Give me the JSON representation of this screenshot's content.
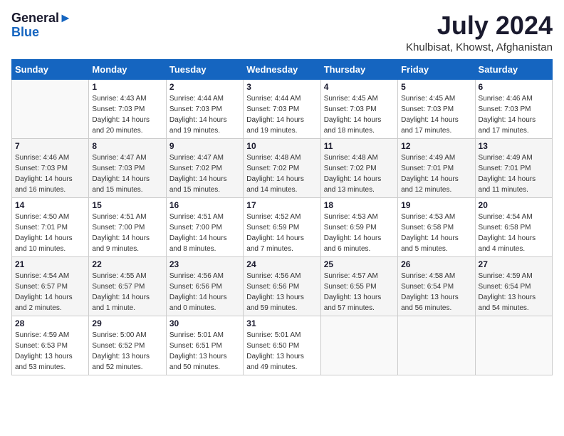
{
  "header": {
    "logo_line1": "General",
    "logo_line2": "Blue",
    "title": "July 2024",
    "location": "Khulbisat, Khowst, Afghanistan"
  },
  "calendar": {
    "columns": [
      "Sunday",
      "Monday",
      "Tuesday",
      "Wednesday",
      "Thursday",
      "Friday",
      "Saturday"
    ],
    "weeks": [
      [
        {
          "day": "",
          "info": ""
        },
        {
          "day": "1",
          "info": "Sunrise: 4:43 AM\nSunset: 7:03 PM\nDaylight: 14 hours\nand 20 minutes."
        },
        {
          "day": "2",
          "info": "Sunrise: 4:44 AM\nSunset: 7:03 PM\nDaylight: 14 hours\nand 19 minutes."
        },
        {
          "day": "3",
          "info": "Sunrise: 4:44 AM\nSunset: 7:03 PM\nDaylight: 14 hours\nand 19 minutes."
        },
        {
          "day": "4",
          "info": "Sunrise: 4:45 AM\nSunset: 7:03 PM\nDaylight: 14 hours\nand 18 minutes."
        },
        {
          "day": "5",
          "info": "Sunrise: 4:45 AM\nSunset: 7:03 PM\nDaylight: 14 hours\nand 17 minutes."
        },
        {
          "day": "6",
          "info": "Sunrise: 4:46 AM\nSunset: 7:03 PM\nDaylight: 14 hours\nand 17 minutes."
        }
      ],
      [
        {
          "day": "7",
          "info": "Sunrise: 4:46 AM\nSunset: 7:03 PM\nDaylight: 14 hours\nand 16 minutes."
        },
        {
          "day": "8",
          "info": "Sunrise: 4:47 AM\nSunset: 7:03 PM\nDaylight: 14 hours\nand 15 minutes."
        },
        {
          "day": "9",
          "info": "Sunrise: 4:47 AM\nSunset: 7:02 PM\nDaylight: 14 hours\nand 15 minutes."
        },
        {
          "day": "10",
          "info": "Sunrise: 4:48 AM\nSunset: 7:02 PM\nDaylight: 14 hours\nand 14 minutes."
        },
        {
          "day": "11",
          "info": "Sunrise: 4:48 AM\nSunset: 7:02 PM\nDaylight: 14 hours\nand 13 minutes."
        },
        {
          "day": "12",
          "info": "Sunrise: 4:49 AM\nSunset: 7:01 PM\nDaylight: 14 hours\nand 12 minutes."
        },
        {
          "day": "13",
          "info": "Sunrise: 4:49 AM\nSunset: 7:01 PM\nDaylight: 14 hours\nand 11 minutes."
        }
      ],
      [
        {
          "day": "14",
          "info": "Sunrise: 4:50 AM\nSunset: 7:01 PM\nDaylight: 14 hours\nand 10 minutes."
        },
        {
          "day": "15",
          "info": "Sunrise: 4:51 AM\nSunset: 7:00 PM\nDaylight: 14 hours\nand 9 minutes."
        },
        {
          "day": "16",
          "info": "Sunrise: 4:51 AM\nSunset: 7:00 PM\nDaylight: 14 hours\nand 8 minutes."
        },
        {
          "day": "17",
          "info": "Sunrise: 4:52 AM\nSunset: 6:59 PM\nDaylight: 14 hours\nand 7 minutes."
        },
        {
          "day": "18",
          "info": "Sunrise: 4:53 AM\nSunset: 6:59 PM\nDaylight: 14 hours\nand 6 minutes."
        },
        {
          "day": "19",
          "info": "Sunrise: 4:53 AM\nSunset: 6:58 PM\nDaylight: 14 hours\nand 5 minutes."
        },
        {
          "day": "20",
          "info": "Sunrise: 4:54 AM\nSunset: 6:58 PM\nDaylight: 14 hours\nand 4 minutes."
        }
      ],
      [
        {
          "day": "21",
          "info": "Sunrise: 4:54 AM\nSunset: 6:57 PM\nDaylight: 14 hours\nand 2 minutes."
        },
        {
          "day": "22",
          "info": "Sunrise: 4:55 AM\nSunset: 6:57 PM\nDaylight: 14 hours\nand 1 minute."
        },
        {
          "day": "23",
          "info": "Sunrise: 4:56 AM\nSunset: 6:56 PM\nDaylight: 14 hours\nand 0 minutes."
        },
        {
          "day": "24",
          "info": "Sunrise: 4:56 AM\nSunset: 6:56 PM\nDaylight: 13 hours\nand 59 minutes."
        },
        {
          "day": "25",
          "info": "Sunrise: 4:57 AM\nSunset: 6:55 PM\nDaylight: 13 hours\nand 57 minutes."
        },
        {
          "day": "26",
          "info": "Sunrise: 4:58 AM\nSunset: 6:54 PM\nDaylight: 13 hours\nand 56 minutes."
        },
        {
          "day": "27",
          "info": "Sunrise: 4:59 AM\nSunset: 6:54 PM\nDaylight: 13 hours\nand 54 minutes."
        }
      ],
      [
        {
          "day": "28",
          "info": "Sunrise: 4:59 AM\nSunset: 6:53 PM\nDaylight: 13 hours\nand 53 minutes."
        },
        {
          "day": "29",
          "info": "Sunrise: 5:00 AM\nSunset: 6:52 PM\nDaylight: 13 hours\nand 52 minutes."
        },
        {
          "day": "30",
          "info": "Sunrise: 5:01 AM\nSunset: 6:51 PM\nDaylight: 13 hours\nand 50 minutes."
        },
        {
          "day": "31",
          "info": "Sunrise: 5:01 AM\nSunset: 6:50 PM\nDaylight: 13 hours\nand 49 minutes."
        },
        {
          "day": "",
          "info": ""
        },
        {
          "day": "",
          "info": ""
        },
        {
          "day": "",
          "info": ""
        }
      ]
    ]
  }
}
